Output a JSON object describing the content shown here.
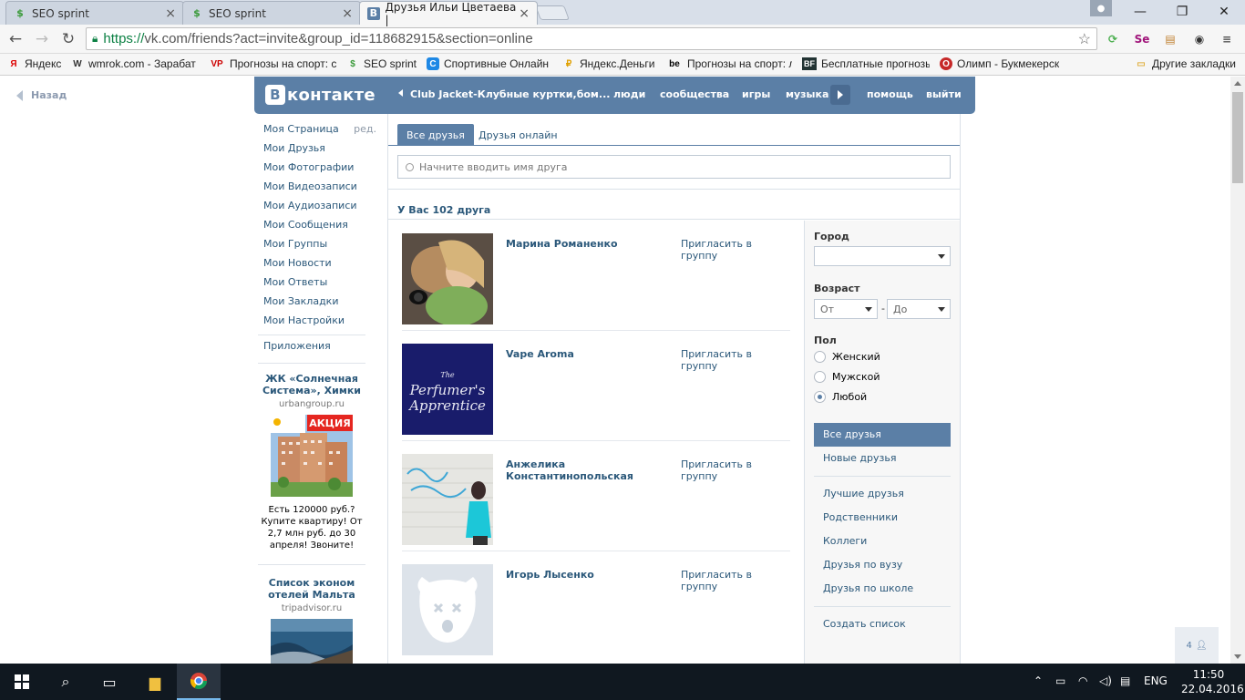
{
  "browser": {
    "tabs": [
      {
        "title": "SEO sprint"
      },
      {
        "title": "SEO sprint"
      },
      {
        "title": "Друзья Ильи Цветаева |"
      }
    ],
    "url_scheme": "https://",
    "url_rest": "vk.com/friends?act=invite&group_id=118682915&section=online",
    "bookmarks": [
      {
        "label": "Яндекс",
        "icon": "Я"
      },
      {
        "label": "wmrok.com - Зарабат",
        "icon": "W"
      },
      {
        "label": "Прогнозы на спорт: с",
        "icon": "VP"
      },
      {
        "label": "SEO sprint",
        "icon": "S"
      },
      {
        "label": "Спортивные Онлайн",
        "icon": "C"
      },
      {
        "label": "Яндекс.Деньги",
        "icon": "₽"
      },
      {
        "label": "Прогнозы на спорт: л",
        "icon": "be"
      },
      {
        "label": "Бесплатные прогнозы",
        "icon": "BF"
      },
      {
        "label": "Олимп - Букмекерск",
        "icon": "O"
      }
    ],
    "other_bookmarks": "Другие закладки"
  },
  "page": {
    "back_label": "Назад",
    "header": {
      "logo_letter": "В",
      "logo_text": "контакте",
      "group_link": "Club Jacket-Клубные куртки,бом...",
      "nav": [
        "люди",
        "сообщества",
        "игры",
        "музыка",
        "помощь",
        "выйти"
      ]
    },
    "left_menu": {
      "items": [
        "Моя Страница",
        "Мои Друзья",
        "Мои Фотографии",
        "Мои Видеозаписи",
        "Мои Аудиозаписи",
        "Мои Сообщения",
        "Мои Группы",
        "Мои Новости",
        "Мои Ответы",
        "Мои Закладки",
        "Мои Настройки"
      ],
      "edit_label": "ред.",
      "apps_label": "Приложения"
    },
    "ads": [
      {
        "title": "ЖК «Солнечная Система», Химки",
        "domain": "urbangroup.ru",
        "badge": "АКЦИЯ",
        "text": "Есть 120000 руб.? Купите квартиру! От 2,7 млн руб. до 30 апреля! Звоните!"
      },
      {
        "title": "Список эконом отелей Мальта",
        "domain": "tripadvisor.ru"
      }
    ],
    "tabs": {
      "all": "Все друзья",
      "online": "Друзья онлайн"
    },
    "search_placeholder": "Начните вводить имя друга",
    "friends_count": "У Вас 102 друга",
    "friends": [
      {
        "name": "Марина Романенко",
        "action": "Пригласить в группу"
      },
      {
        "name": "Vape Aroma",
        "action": "Пригласить в группу",
        "photo_text_1": "The",
        "photo_text_2": "Perfumer's",
        "photo_text_3": "Apprentice"
      },
      {
        "name": "Анжелика Константинопольская",
        "action": "Пригласить в группу"
      },
      {
        "name": "Игорь Лысенко",
        "action": "Пригласить в группу"
      }
    ],
    "filter": {
      "city_label": "Город",
      "city_value": "",
      "age_label": "Возраст",
      "age_from": "От",
      "age_dash": "-",
      "age_to": "До",
      "gender_label": "Пол",
      "genders": [
        "Женский",
        "Мужской",
        "Любой"
      ],
      "gender_selected": "Любой",
      "nav": [
        "Все друзья",
        "Новые друзья",
        "Лучшие друзья",
        "Родственники",
        "Коллеги",
        "Друзья по вузу",
        "Друзья по школе",
        "Создать список"
      ]
    },
    "online_count": "4"
  },
  "taskbar": {
    "lang": "ENG",
    "time": "11:50",
    "date": "22.04.2016"
  },
  "colors": {
    "vk_blue": "#5b7fa6",
    "link": "#2b587a"
  }
}
